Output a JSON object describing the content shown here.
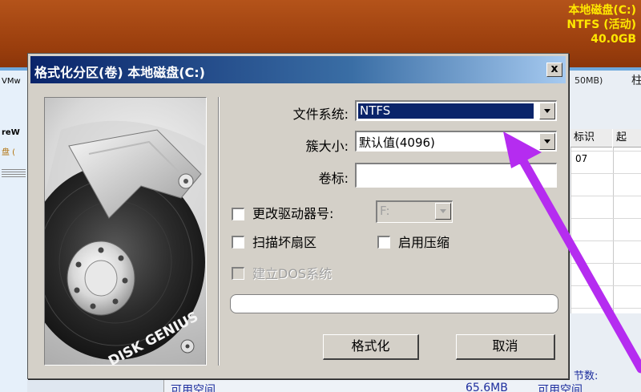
{
  "background": {
    "disk_info": [
      "本地磁盘(C:)",
      "NTFS (活动)",
      "40.0GB"
    ],
    "left_labels": [
      "VMw",
      "reW",
      "盘 ("
    ],
    "right_header": "50MB)",
    "right_suffix": "柱",
    "columns": [
      "标识",
      "起"
    ],
    "cell_value": "07",
    "sectors_label": "节数:",
    "bottom_left": "可用空间",
    "bottom_mid": "65.6MB",
    "bottom_right": "可用空间"
  },
  "dialog": {
    "title": "格式化分区(卷) 本地磁盘(C:)",
    "close_label": "x",
    "illustration_brand": "DISK GENIUS",
    "fs_label": "文件系统:",
    "fs_value": "NTFS",
    "cluster_label": "簇大小:",
    "cluster_value": "默认值(4096)",
    "volume_label": "卷标:",
    "volume_value": "",
    "change_drive_label": "更改驱动器号:",
    "drive_letter_value": "F:",
    "scan_bad_label": "扫描坏扇区",
    "compress_label": "启用压缩",
    "dos_label": "建立DOS系统",
    "format_button": "格式化",
    "cancel_button": "取消"
  },
  "colors": {
    "header_brown": "#9a3e0d",
    "disk_info_yellow": "#ffe800",
    "title_blue": "#0a246a",
    "dialog_gray": "#d4d0c8",
    "annotation_purple": "#b52cf0"
  },
  "icons": [
    "close-icon",
    "dropdown-arrow-icon",
    "hard-disk-illustration",
    "annotation-arrow"
  ]
}
